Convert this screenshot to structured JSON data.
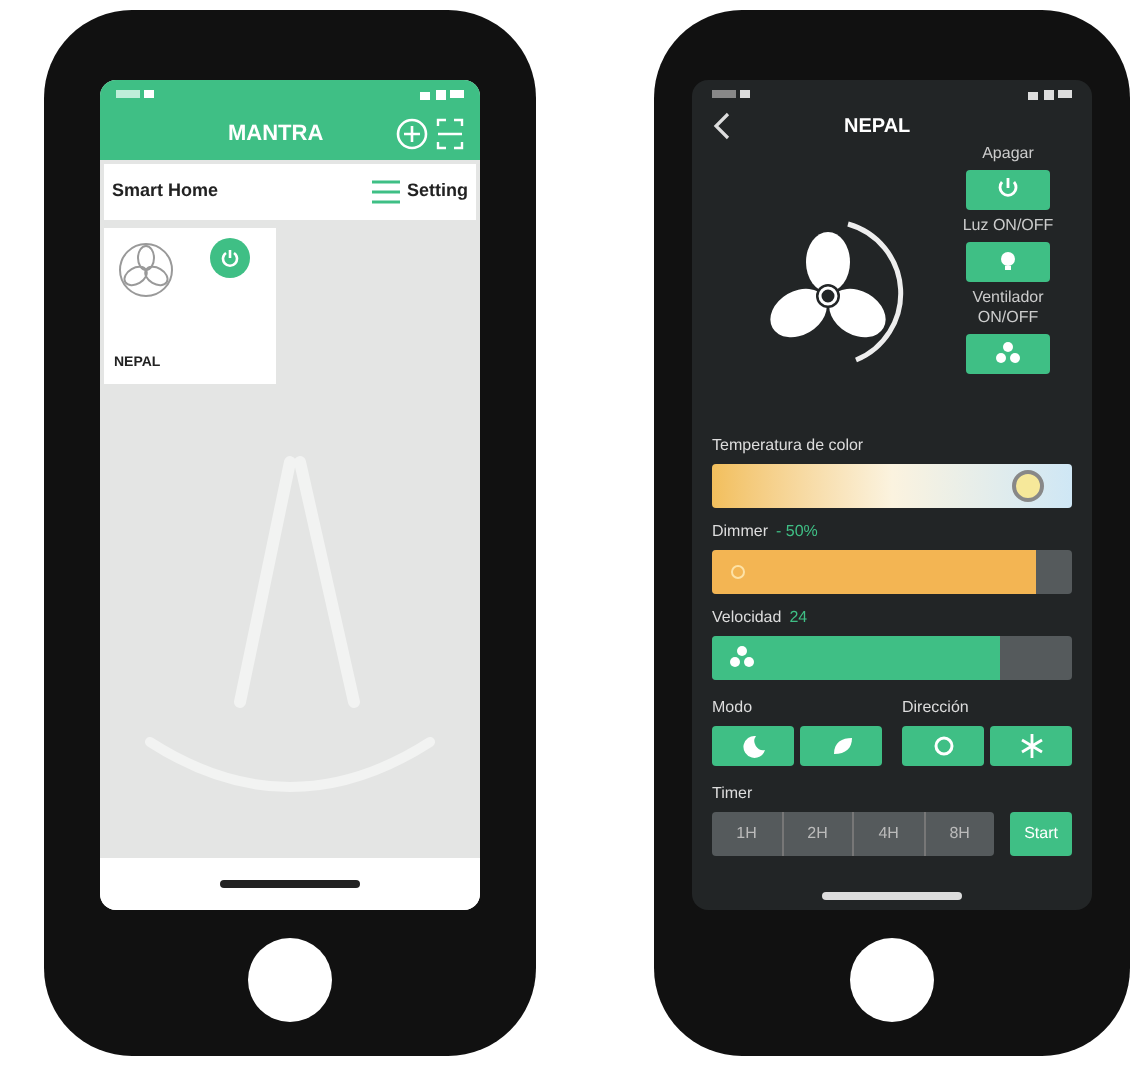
{
  "home_screen": {
    "header": {
      "title": "MANTRA"
    },
    "toolbar": {
      "title": "Smart Home",
      "setting": "Setting"
    },
    "devices": [
      {
        "name": "NEPAL",
        "on": true
      }
    ]
  },
  "device_screen": {
    "title": "NEPAL",
    "actions": [
      {
        "label": "Apagar",
        "kind": "power"
      },
      {
        "label": "Luz ON/OFF",
        "kind": "light"
      },
      {
        "label": "Ventilador ON/OFF",
        "kind": "fan"
      }
    ],
    "color_temperature": {
      "label": "Temperatura de color",
      "level": 0.88
    },
    "dimmer": {
      "label": "Dimmer",
      "reading": "- 50%",
      "level": 0.9
    },
    "speed": {
      "label": "Velocidad",
      "reading": "24",
      "level": 0.8
    },
    "mode": {
      "label": "Modo",
      "options": [
        {
          "kind": "moon"
        },
        {
          "kind": "leaf"
        }
      ]
    },
    "direction": {
      "label": "Dirección",
      "options": [
        {
          "kind": "sun"
        },
        {
          "kind": "snowflake"
        }
      ]
    },
    "timer": {
      "label": "Timer",
      "options": [
        {
          "label": "1H"
        },
        {
          "label": "2H"
        },
        {
          "label": "4H"
        },
        {
          "label": "8H"
        }
      ],
      "start": "Start"
    }
  }
}
